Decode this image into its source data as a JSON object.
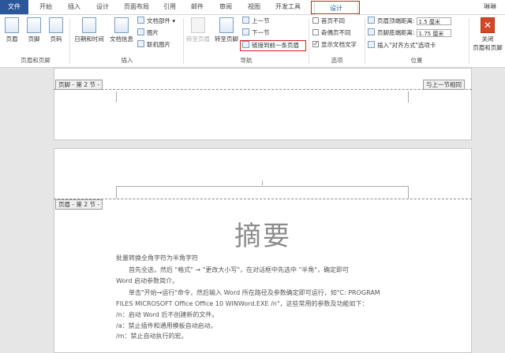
{
  "tabs": [
    "文件",
    "开始",
    "插入",
    "设计",
    "页面布局",
    "引用",
    "邮件",
    "审阅",
    "视图",
    "开发工具",
    "设计"
  ],
  "user": "琳琳",
  "ribbon": {
    "hf_group": {
      "header": "页眉",
      "footer": "页脚",
      "page_number": "页码",
      "label": "页眉和页脚"
    },
    "insert_group": {
      "datetime": "日期和时间",
      "docinfo": "文档信息",
      "docparts": "文档部件",
      "picture": "图片",
      "online_picture": "联机图片",
      "label": "插入"
    },
    "nav_group": {
      "goto_header": "转至页眉",
      "goto_footer": "转至页脚",
      "prev": "上一节",
      "next": "下一节",
      "link_prev": "链接到前一条页眉",
      "label": "导航"
    },
    "options_group": {
      "diff_first": "首页不同",
      "diff_odd_even": "奇偶页不同",
      "show_text": "显示文档文字",
      "label": "选项"
    },
    "position_group": {
      "header_dist_label": "页眉顶端距离:",
      "header_dist": "1.5 厘米",
      "footer_dist_label": "页脚底端距离:",
      "footer_dist": "1.75 厘米",
      "insert_align_tab": "插入\"对齐方式\"选项卡",
      "label": "位置"
    },
    "close_group": {
      "close_line1": "关闭",
      "close_line2": "页眉和页脚",
      "label": "关闭"
    }
  },
  "doc": {
    "footer_tag": "页脚 - 第 2 节 -",
    "same_as_prev": "与上一节相同",
    "header_tag": "页眉 - 第 2 节 -",
    "title": "摘要",
    "lines": [
      "批量转换全角字符为半角字符",
      "首先全选，然后 \"格式\" → \"更改大小写\"，在对话框中先选中 \"半角\"，确定即可",
      "Word 启动参数简介。",
      "单击\"开始→运行\"命令，然后输入 Word 所在路径及参数确定即可运行，如\"C: PROGRAM",
      "FILES MICROSOFT Office Office 10 WINWord.EXE /n\"，这些常用的参数及功能如下：",
      "/n：启动 Word 后不创建新的文件。",
      "/a：禁止插件和通用模板自动启动。",
      "/m：禁止自动执行的宏。"
    ]
  }
}
